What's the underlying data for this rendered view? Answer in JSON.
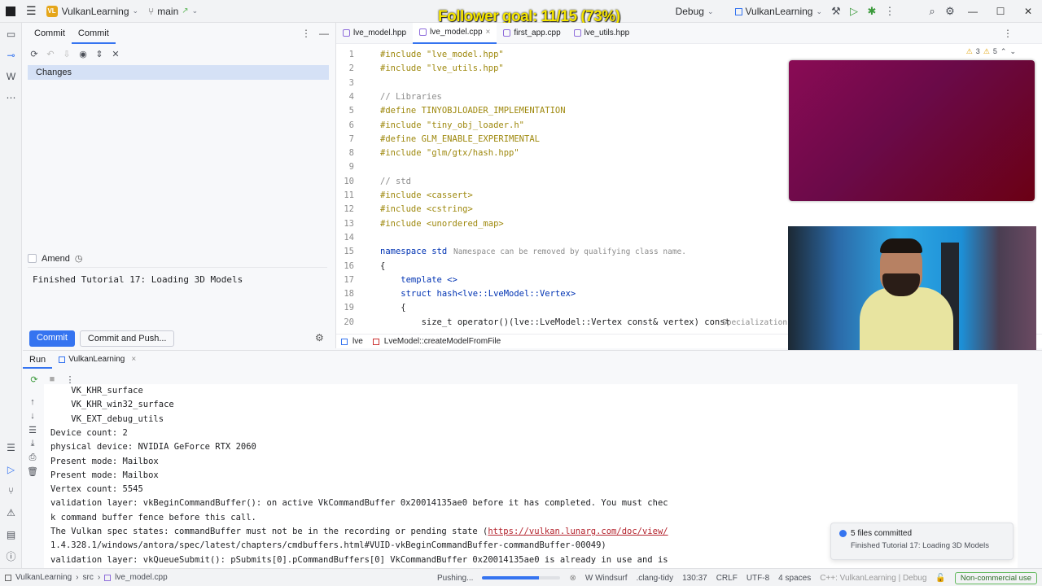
{
  "titlebar": {
    "project_badge": "VL",
    "project_name": "VulkanLearning",
    "branch": "main",
    "run_config": "Debug",
    "target": "VulkanLearning"
  },
  "overlay": {
    "follower_goal": "Follower goal: 11/15 (73%)"
  },
  "commit_panel": {
    "tabs": [
      "Commit",
      "Commit"
    ],
    "changes_label": "Changes",
    "amend_label": "Amend",
    "message": "Finished Tutorial 17: Loading 3D Models",
    "commit_button": "Commit",
    "commit_push_button": "Commit and Push..."
  },
  "editor": {
    "tabs": [
      {
        "label": "lve_model.hpp",
        "active": false
      },
      {
        "label": "lve_model.cpp",
        "active": true
      },
      {
        "label": "first_app.cpp",
        "active": false
      },
      {
        "label": "lve_utils.hpp",
        "active": false
      }
    ],
    "warnings": "3",
    "weak_warnings": "5",
    "lines": [
      {
        "n": "1",
        "text": "#include \"lve_model.hpp\""
      },
      {
        "n": "2",
        "text": "#include \"lve_utils.hpp\""
      },
      {
        "n": "3",
        "text": ""
      },
      {
        "n": "4",
        "text": "// Libraries"
      },
      {
        "n": "5",
        "text": "#define TINYOBJLOADER_IMPLEMENTATION"
      },
      {
        "n": "6",
        "text": "#include \"tiny_obj_loader.h\""
      },
      {
        "n": "7",
        "text": "#define GLM_ENABLE_EXPERIMENTAL"
      },
      {
        "n": "8",
        "text": "#include \"glm/gtx/hash.hpp\""
      },
      {
        "n": "9",
        "text": ""
      },
      {
        "n": "10",
        "text": "// std"
      },
      {
        "n": "11",
        "text": "#include <cassert>"
      },
      {
        "n": "12",
        "text": "#include <cstring>"
      },
      {
        "n": "13",
        "text": "#include <unordered_map>"
      },
      {
        "n": "14",
        "text": ""
      },
      {
        "n": "15",
        "text": "namespace std"
      },
      {
        "n": "16",
        "text": "{"
      },
      {
        "n": "17",
        "text": "    template <>"
      },
      {
        "n": "18",
        "text": "    struct hash<lve::LveModel::Vertex>"
      },
      {
        "n": "19",
        "text": "    {"
      },
      {
        "n": "20",
        "text": "        size_t operator()(lve::LveModel::Vertex const& vertex) const"
      }
    ],
    "hint_line15": "Namespace can be removed by qualifying class name.",
    "hint_line20": "Specialization",
    "breadcrumb": [
      "lve",
      "LveModel::createModelFromFile"
    ]
  },
  "run_panel": {
    "label": "Run",
    "tab": "VulkanLearning",
    "console_lines": [
      "    VK_KHR_surface",
      "    VK_KHR_win32_surface",
      "    VK_EXT_debug_utils",
      "Device count: 2",
      "physical device: NVIDIA GeForce RTX 2060",
      "Present mode: Mailbox",
      "Present mode: Mailbox",
      "Vertex count: 5545",
      "validation layer: vkBeginCommandBuffer(): on active VkCommandBuffer 0x20014135ae0 before it has completed. You must chec",
      "k command buffer fence before this call.",
      "The Vulkan spec states: commandBuffer must not be in the recording or pending state (",
      "1.4.328.1/windows/antora/spec/latest/chapters/cmdbuffers.html#VUID-vkBeginCommandBuffer-commandBuffer-00049)",
      "validation layer: vkQueueSubmit(): pSubmits[0].pCommandBuffers[0] VkCommandBuffer 0x20014135ae0 is already in use and is"
    ],
    "link_text": "https://vulkan.lunarg.com/doc/view/",
    "link_suffix": ")"
  },
  "notification": {
    "title": "5 files committed",
    "body": "Finished Tutorial 17: Loading 3D Models"
  },
  "statusbar": {
    "path": [
      "VulkanLearning",
      "src",
      "lve_model.cpp"
    ],
    "pushing": "Pushing...",
    "progress": 0.72,
    "windsurf": "Windsurf",
    "clang_tidy": ".clang-tidy",
    "position": "130:37",
    "line_ending": "CRLF",
    "encoding": "UTF-8",
    "indent": "4 spaces",
    "context": "C++: VulkanLearning | Debug",
    "license": "Non-commercial use"
  }
}
